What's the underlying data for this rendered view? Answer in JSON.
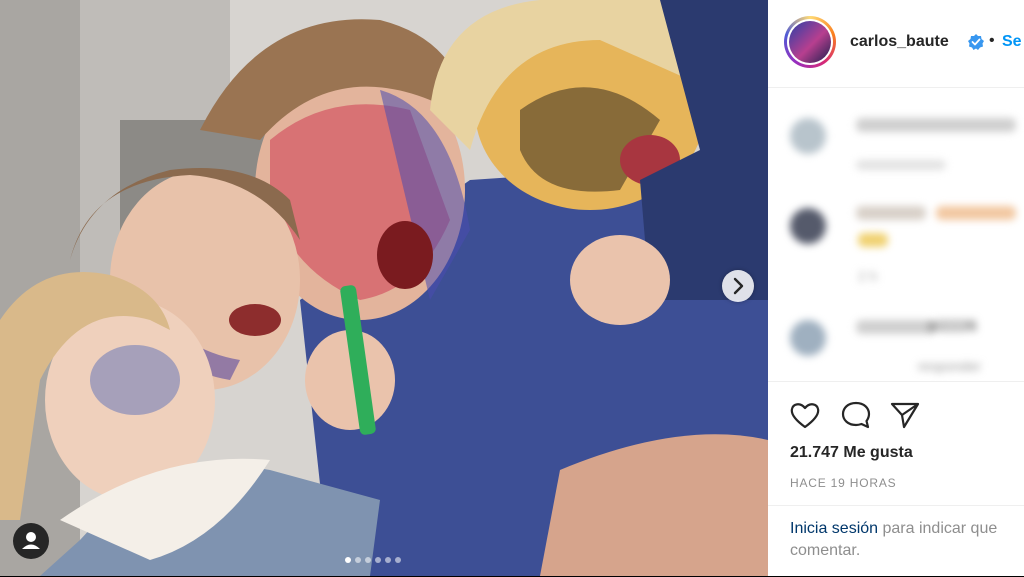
{
  "post": {
    "username": "carlos_baute",
    "follow_label": "Se",
    "separator": "•",
    "likes": "21.747 Me gusta",
    "time": "HACE 19 HORAS",
    "login_link": "Inicia sesión",
    "login_rest_line1": " para indicar que",
    "login_line2": "comentar."
  },
  "comments": {
    "partial_text_1": "el2226",
    "partial_text_2": "responder",
    "partial_text_3": "2 h"
  },
  "carousel": {
    "slide_count": 6,
    "active_index": 0
  },
  "icons": {
    "like": "heart-icon",
    "comment": "comment-icon",
    "share": "share-icon",
    "next": "chevron-right-icon",
    "user": "user-icon",
    "verified": "verified-badge-icon"
  },
  "colors": {
    "link": "#0095f6",
    "text": "#262626",
    "muted": "#8e8e8e",
    "verified": "#3897f0"
  }
}
